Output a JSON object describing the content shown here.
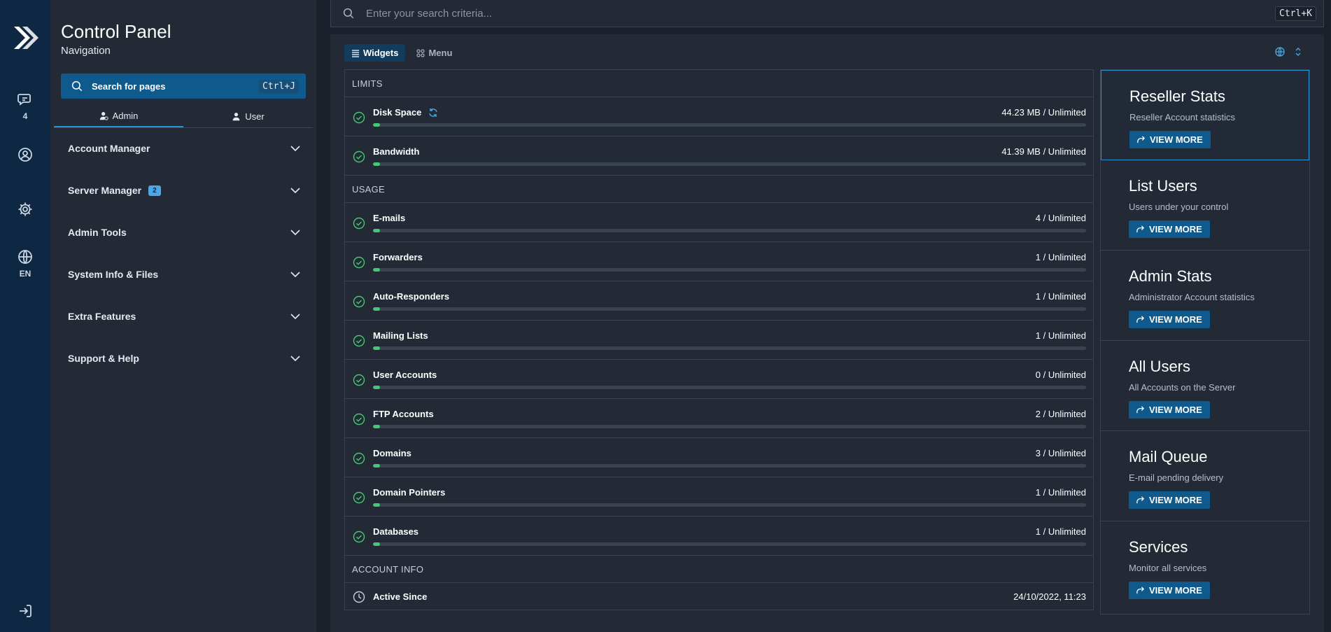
{
  "rail": {
    "messages_count": "4",
    "language": "EN"
  },
  "nav": {
    "title": "Control Panel",
    "subtitle": "Navigation",
    "search_label": "Search for pages",
    "search_shortcut": "Ctrl+J",
    "tabs": [
      {
        "label": "Admin",
        "icon": "admin-user-icon",
        "active": true
      },
      {
        "label": "User",
        "icon": "user-icon",
        "active": false
      }
    ],
    "items": [
      {
        "label": "Account Manager"
      },
      {
        "label": "Server Manager",
        "badge": "2"
      },
      {
        "label": "Admin Tools"
      },
      {
        "label": "System Info & Files"
      },
      {
        "label": "Extra Features"
      },
      {
        "label": "Support & Help"
      }
    ]
  },
  "search": {
    "placeholder": "Enter your search criteria...",
    "shortcut": "Ctrl+K"
  },
  "view_tabs": {
    "widgets": "Widgets",
    "menu": "Menu"
  },
  "limits": {
    "heading": "LIMITS",
    "rows": [
      {
        "name": "Disk Space",
        "value": "44.23 MB / Unlimited",
        "fill": 0.01
      },
      {
        "name": "Bandwidth",
        "value": "41.39 MB / Unlimited",
        "fill": 0.01
      }
    ]
  },
  "usage": {
    "heading": "USAGE",
    "rows": [
      {
        "name": "E-mails",
        "value": "4 / Unlimited",
        "fill": 0.01
      },
      {
        "name": "Forwarders",
        "value": "1 / Unlimited",
        "fill": 0.01
      },
      {
        "name": "Auto-Responders",
        "value": "1 / Unlimited",
        "fill": 0.01
      },
      {
        "name": "Mailing Lists",
        "value": "1 / Unlimited",
        "fill": 0.01
      },
      {
        "name": "User Accounts",
        "value": "0 / Unlimited",
        "fill": 0.01
      },
      {
        "name": "FTP Accounts",
        "value": "2 / Unlimited",
        "fill": 0.01
      },
      {
        "name": "Domains",
        "value": "3 / Unlimited",
        "fill": 0.01
      },
      {
        "name": "Domain Pointers",
        "value": "1 / Unlimited",
        "fill": 0.01
      },
      {
        "name": "Databases",
        "value": "1 / Unlimited",
        "fill": 0.01
      }
    ]
  },
  "account_info": {
    "heading": "ACCOUNT INFO",
    "active_since_label": "Active Since",
    "active_since_value": "24/10/2022, 11:23"
  },
  "cards": [
    {
      "title": "Reseller Stats",
      "desc": "Reseller Account statistics",
      "button": "VIEW MORE"
    },
    {
      "title": "List Users",
      "desc": "Users under your control",
      "button": "VIEW MORE"
    },
    {
      "title": "Admin Stats",
      "desc": "Administrator Account statistics",
      "button": "VIEW MORE"
    },
    {
      "title": "All Users",
      "desc": "All Accounts on the Server",
      "button": "VIEW MORE"
    },
    {
      "title": "Mail Queue",
      "desc": "E-mail pending delivery",
      "button": "VIEW MORE"
    },
    {
      "title": "Services",
      "desc": "Monitor all services",
      "button": "VIEW MORE"
    }
  ],
  "colors": {
    "accent": "#0e5a8c",
    "progress": "#44c776",
    "rail": "#0e2843",
    "check": "#44c776"
  }
}
